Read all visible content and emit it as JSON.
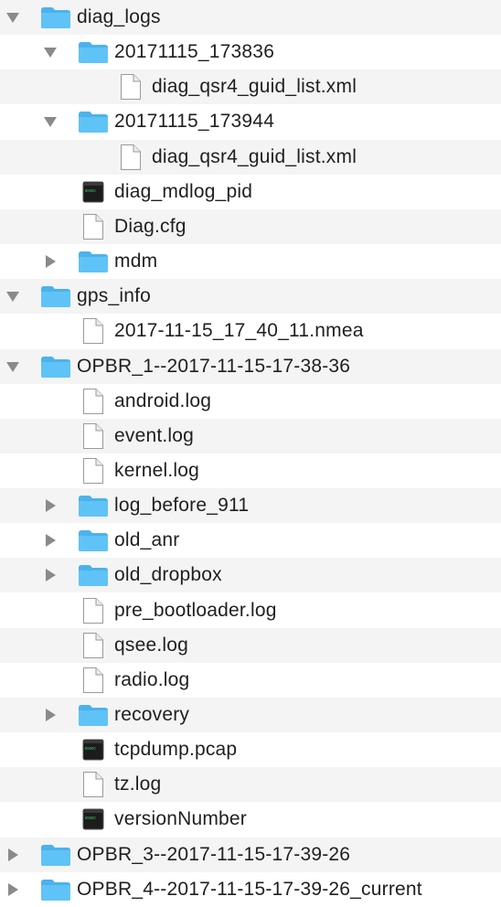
{
  "colors": {
    "folder": "#5fc3f7",
    "folder_tab": "#4cb2ec",
    "disclosure": "#8a8a8a",
    "row_alt": "#f4f4f4",
    "text": "#1f1f1f"
  },
  "items": [
    {
      "name": "diag_logs",
      "kind": "folder",
      "depth": 0,
      "expanded": true
    },
    {
      "name": "20171115_173836",
      "kind": "folder",
      "depth": 1,
      "expanded": true
    },
    {
      "name": "diag_qsr4_guid_list.xml",
      "kind": "file",
      "depth": 2
    },
    {
      "name": "20171115_173944",
      "kind": "folder",
      "depth": 1,
      "expanded": true
    },
    {
      "name": "diag_qsr4_guid_list.xml",
      "kind": "file",
      "depth": 2
    },
    {
      "name": "diag_mdlog_pid",
      "kind": "exec",
      "depth": 1
    },
    {
      "name": "Diag.cfg",
      "kind": "file",
      "depth": 1
    },
    {
      "name": "mdm",
      "kind": "folder",
      "depth": 1,
      "expanded": false
    },
    {
      "name": "gps_info",
      "kind": "folder",
      "depth": 0,
      "expanded": true
    },
    {
      "name": "2017-11-15_17_40_11.nmea",
      "kind": "file",
      "depth": 1
    },
    {
      "name": "OPBR_1--2017-11-15-17-38-36",
      "kind": "folder",
      "depth": 0,
      "expanded": true
    },
    {
      "name": "android.log",
      "kind": "file",
      "depth": 1
    },
    {
      "name": "event.log",
      "kind": "file",
      "depth": 1
    },
    {
      "name": "kernel.log",
      "kind": "file",
      "depth": 1
    },
    {
      "name": "log_before_911",
      "kind": "folder",
      "depth": 1,
      "expanded": false
    },
    {
      "name": "old_anr",
      "kind": "folder",
      "depth": 1,
      "expanded": false
    },
    {
      "name": "old_dropbox",
      "kind": "folder",
      "depth": 1,
      "expanded": false
    },
    {
      "name": "pre_bootloader.log",
      "kind": "file",
      "depth": 1
    },
    {
      "name": "qsee.log",
      "kind": "file",
      "depth": 1
    },
    {
      "name": "radio.log",
      "kind": "file",
      "depth": 1
    },
    {
      "name": "recovery",
      "kind": "folder",
      "depth": 1,
      "expanded": false
    },
    {
      "name": "tcpdump.pcap",
      "kind": "exec",
      "depth": 1
    },
    {
      "name": "tz.log",
      "kind": "file",
      "depth": 1
    },
    {
      "name": "versionNumber",
      "kind": "exec",
      "depth": 1
    },
    {
      "name": "OPBR_3--2017-11-15-17-39-26",
      "kind": "folder",
      "depth": 0,
      "expanded": false
    },
    {
      "name": "OPBR_4--2017-11-15-17-39-26_current",
      "kind": "folder",
      "depth": 0,
      "expanded": false
    }
  ]
}
